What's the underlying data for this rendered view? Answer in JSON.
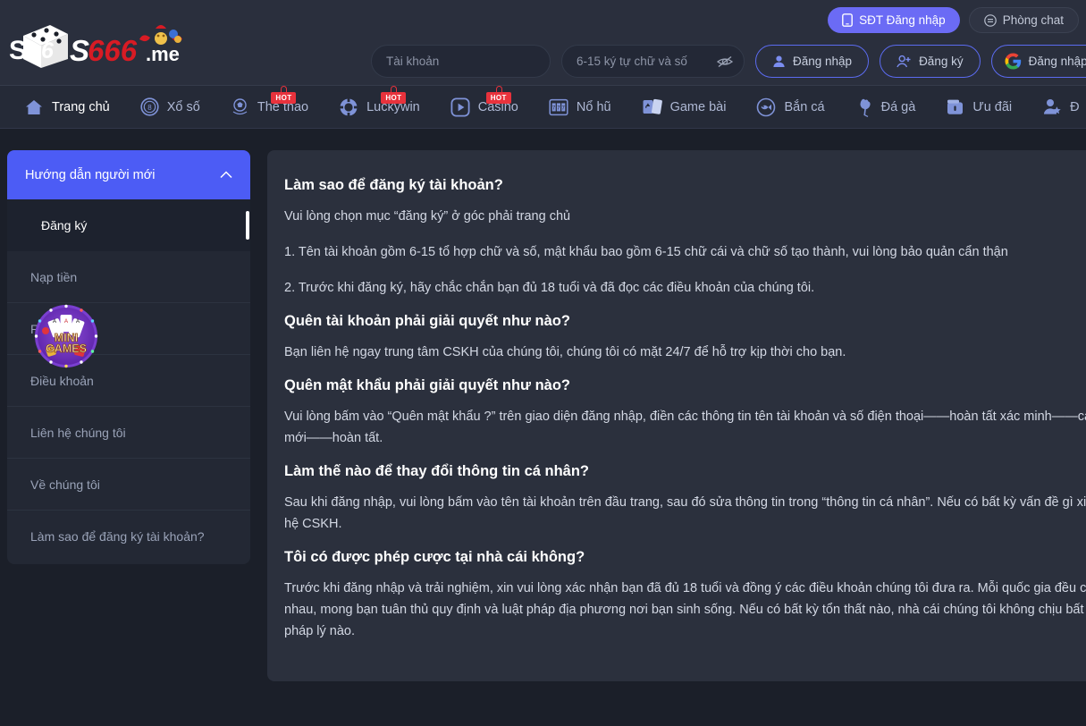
{
  "brand": {
    "name_main": "S6S666",
    "name_suffix": ".me"
  },
  "header": {
    "phone_login_button": "SĐT Đăng nhập",
    "chat_room_button": "Phòng chat",
    "account_placeholder": "Tài khoản",
    "account_value": "",
    "password_placeholder": "6-15 ký tự chữ và số",
    "password_value": "",
    "login_button": "Đăng nhập",
    "register_button": "Đăng ký",
    "google_login_button": "Đăng nhập",
    "accent_blue": "#6b6bf5",
    "outline_blue": "#5b6bf0"
  },
  "nav": {
    "hot_label": "HOT",
    "items": [
      {
        "label": "Trang chủ",
        "icon": "home-icon",
        "hot": false,
        "active": true
      },
      {
        "label": "Xổ số",
        "icon": "lottery-ball-icon",
        "hot": false,
        "active": false
      },
      {
        "label": "Thể thao",
        "icon": "soccer-ball-icon",
        "hot": true,
        "active": false
      },
      {
        "label": "Luckywin",
        "icon": "poker-chip-icon",
        "hot": true,
        "active": false
      },
      {
        "label": "Casino",
        "icon": "play-circle-icon",
        "hot": true,
        "active": false
      },
      {
        "label": "Nổ hũ",
        "icon": "slot-machine-icon",
        "hot": false,
        "active": false
      },
      {
        "label": "Game bài",
        "icon": "playing-cards-icon",
        "hot": false,
        "active": false
      },
      {
        "label": "Bắn cá",
        "icon": "fish-icon",
        "hot": false,
        "active": false
      },
      {
        "label": "Đá gà",
        "icon": "rooster-icon",
        "hot": false,
        "active": false
      },
      {
        "label": "Ưu đãi",
        "icon": "wallet-gift-icon",
        "hot": false,
        "active": false
      },
      {
        "label": "Đ",
        "icon": "user-star-icon",
        "hot": false,
        "active": false
      }
    ]
  },
  "sidebar": {
    "header_title": "Hướng dẫn người mới",
    "header_expanded": true,
    "items": [
      {
        "label": "Đăng ký",
        "active": true
      },
      {
        "label": "Nạp tiền",
        "active": false
      },
      {
        "label": "Rút tiền",
        "active": false
      },
      {
        "label": "Điều khoản",
        "active": false
      },
      {
        "label": "Liên hệ chúng tôi",
        "active": false
      },
      {
        "label": "Về chúng tôi",
        "active": false
      },
      {
        "label": "Làm sao để đăng ký tài khoản?",
        "active": false
      }
    ],
    "minigames_badge": {
      "line1": "MINI",
      "line2": "GAMES"
    }
  },
  "content": {
    "faq": [
      {
        "question": "Làm sao để đăng ký tài khoản?",
        "answers": [
          "Vui lòng chọn mục “đăng ký” ở góc phải trang chủ",
          "1. Tên tài khoản gồm 6-15 tổ hợp chữ và số, mật khẩu bao gồm 6-15 chữ cái và chữ số tạo thành, vui lòng bảo quản cẩn thận",
          "2. Trước khi đăng ký, hãy chắc chắn bạn đủ 18 tuổi và đã đọc các điều khoản của chúng tôi."
        ]
      },
      {
        "question": "Quên tài khoản phải giải quyết như nào?",
        "answers": [
          "Bạn liên hệ ngay trung tâm CSKH của chúng tôi, chúng tôi có mặt 24/7 để hỗ trợ kịp thời cho bạn."
        ]
      },
      {
        "question": "Quên mật khẩu phải giải quyết như nào?",
        "answers": [
          "Vui lòng bấm vào “Quên mật khẩu ?” trên giao diện đăng nhập, điền các thông tin tên tài khoản và số điện thoại——hoàn tất xác minh——cài đặt mật khẩu mới——hoàn tất."
        ]
      },
      {
        "question": "Làm thế nào để thay đổi thông tin cá nhân?",
        "answers": [
          "Sau khi đăng nhập, vui lòng bấm vào tên tài khoản trên đầu trang, sau đó sửa thông tin trong “thông tin cá nhân”. Nếu có bất kỳ vấn đề gì xin vui lòng liên hệ CSKH."
        ]
      },
      {
        "question": "Tôi có được phép cược tại nhà cái không?",
        "answers": [
          "Trước khi đăng nhập và trải nghiệm, xin vui lòng xác nhận bạn đã đủ 18 tuổi và đồng ý các điều khoản chúng tôi đưa ra. Mỗi quốc gia đều có quy định khác nhau, mong bạn tuân thủ quy định và luật pháp địa phương nơi bạn sinh sống. Nếu có bất kỳ tổn thất nào, nhà cái chúng tôi không chịu bất kỳ trách nhiệm pháp lý nào."
        ]
      }
    ]
  }
}
